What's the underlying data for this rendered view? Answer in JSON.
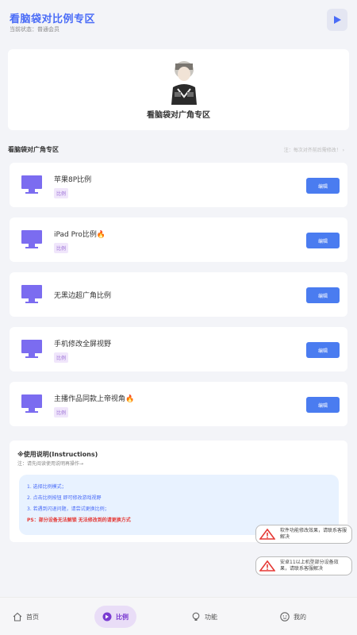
{
  "header": {
    "title": "看脑袋对比例专区",
    "subtitle": "当前状态：普通会员"
  },
  "hero": {
    "title": "看脑袋对广角专区"
  },
  "section": {
    "title": "看脑袋对广角专区",
    "hint": "注：每次对齐前后需修改！ ›"
  },
  "cards": [
    {
      "name": "苹果8P比例",
      "tag": "比例",
      "button": "编辑"
    },
    {
      "name": "iPad Pro比例🔥",
      "tag": "比例",
      "button": "编辑"
    },
    {
      "name": "无黑边超广角比例",
      "tag": "",
      "button": "编辑"
    },
    {
      "name": "手机修改全屏视野",
      "tag": "比例",
      "button": "编辑"
    },
    {
      "name": "主播作品同款上帝视角🔥",
      "tag": "比例",
      "button": "编辑"
    }
  ],
  "instructions": {
    "title": "※使用说明(Instructions)",
    "note": "注：请先阅读使用说明再操作→",
    "lines": [
      "1. 选择比例模式；",
      "2. 点击比例按钮 即可修改游戏视野",
      "3. 若遇到闪退问题，请尝试更换比例；"
    ],
    "warning": "PS：部分设备无法解锁 无法修改到的请更换方式"
  },
  "toasts": [
    "软件功能修改效果，请联系客服解决",
    "安卓11以上机型部分设备效果，请联系客服解决"
  ],
  "tabs": [
    {
      "label": "首页",
      "icon": "home-icon"
    },
    {
      "label": "比例",
      "icon": "ratio-icon"
    },
    {
      "label": "功能",
      "icon": "bulb-icon"
    },
    {
      "label": "我的",
      "icon": "user-icon"
    }
  ],
  "colors": {
    "accent": "#4a6cf7",
    "button": "#4a7cf0",
    "tag": "#9b6fd6",
    "warning": "#e53935",
    "active_tab": "#e9ddf7"
  }
}
